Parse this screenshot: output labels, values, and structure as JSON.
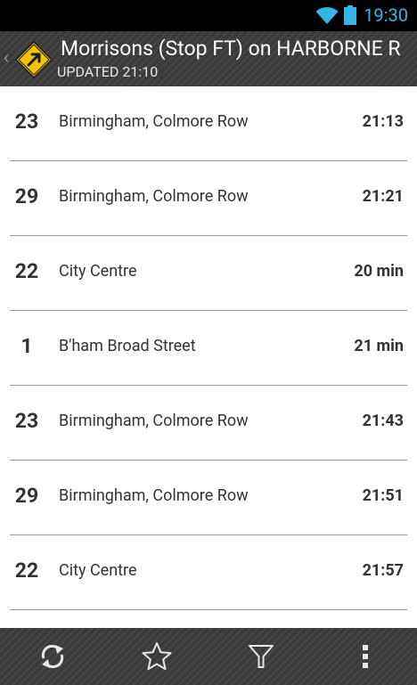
{
  "status_bar": {
    "time": "19:30",
    "accent_color": "#33b5e5"
  },
  "action_bar": {
    "back_caret": "‹",
    "title": "Morrisons  (Stop FT) on HARBORNE R",
    "subtitle": "UPDATED 21:10",
    "icon": "yellow-diamond-arrow-icon"
  },
  "departures": [
    {
      "route": "23",
      "destination": "Birmingham, Colmore Row",
      "time": "21:13"
    },
    {
      "route": "29",
      "destination": "Birmingham, Colmore Row",
      "time": "21:21"
    },
    {
      "route": "22",
      "destination": "City Centre",
      "time": "20 min"
    },
    {
      "route": "1",
      "destination": "B'ham Broad Street",
      "time": "21 min"
    },
    {
      "route": "23",
      "destination": "Birmingham, Colmore Row",
      "time": "21:43"
    },
    {
      "route": "29",
      "destination": "Birmingham, Colmore Row",
      "time": "21:51"
    },
    {
      "route": "22",
      "destination": "City Centre",
      "time": "21:57"
    }
  ],
  "bottom_bar": {
    "buttons": [
      "refresh-icon",
      "star-icon",
      "filter-icon",
      "overflow-menu-icon"
    ]
  }
}
